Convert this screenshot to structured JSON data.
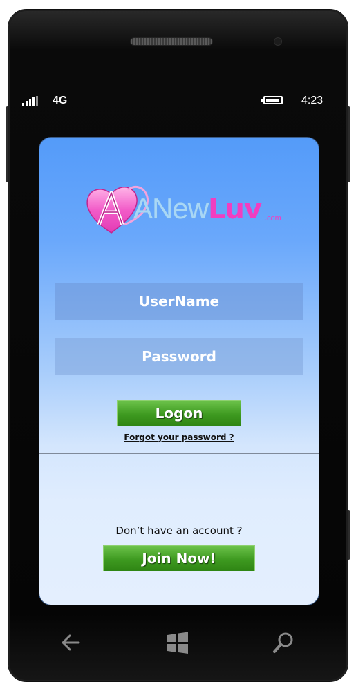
{
  "status_bar": {
    "signal_icon": "signal-bars-icon",
    "network": "4G",
    "battery_icon": "battery-icon",
    "battery_level": 0.9,
    "time": "4:23"
  },
  "app": {
    "logo": {
      "part1": "ANew",
      "part2": "Luv",
      "tld": ".com"
    },
    "username_placeholder": "UserName",
    "password_placeholder": "Password",
    "logon_label": "Logon",
    "forgot_password": "Forgot your password ?",
    "no_account_text": "Don’t have an account ?",
    "join_label": "Join Now!"
  },
  "nav_bar": {
    "back_icon": "back-arrow-icon",
    "home_icon": "windows-logo-icon",
    "search_icon": "search-icon"
  },
  "colors": {
    "screen_top": "#549bf9",
    "screen_bottom": "#e4effe",
    "button_green": "#3e9a20",
    "logo_pink": "#f13ec0",
    "logo_blue": "#a9d7f5"
  }
}
